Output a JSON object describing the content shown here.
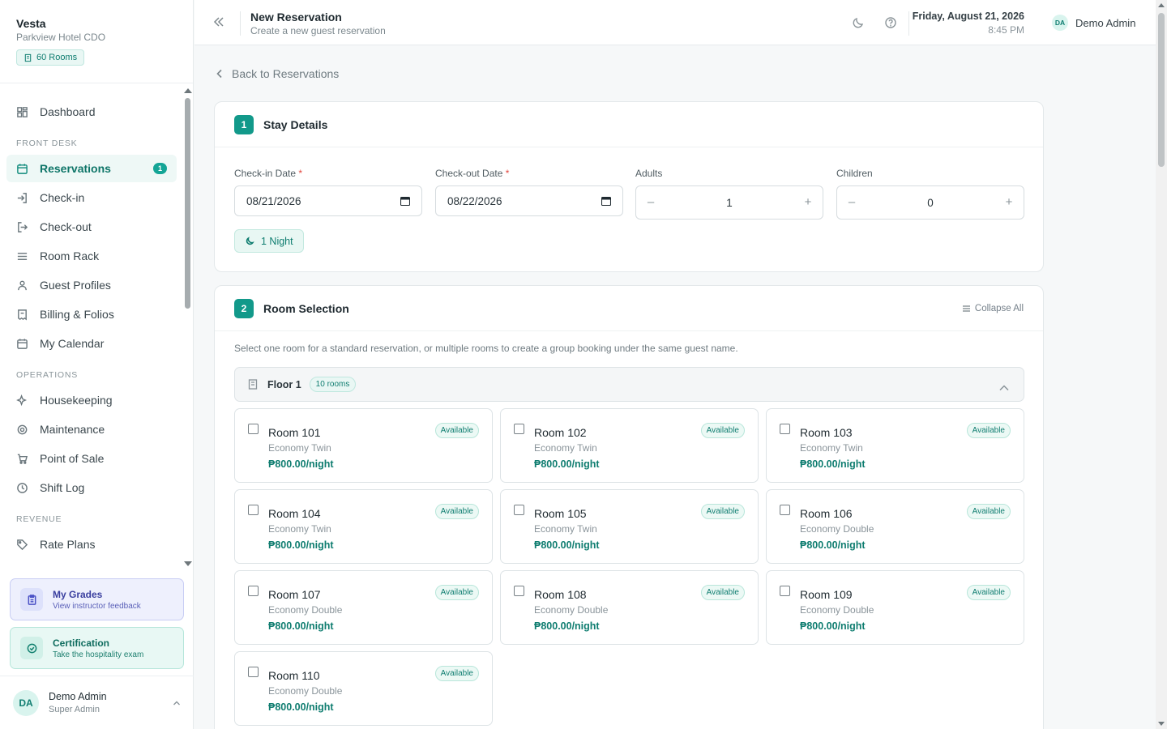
{
  "brand": {
    "name": "Vesta",
    "property": "Parkview Hotel CDO",
    "rooms_pill": "60 Rooms"
  },
  "nav": {
    "dashboard": "Dashboard",
    "section_front_desk": "FRONT DESK",
    "reservations": "Reservations",
    "reservations_badge": "1",
    "check_in": "Check-in",
    "check_out": "Check-out",
    "room_rack": "Room Rack",
    "guest_profiles": "Guest Profiles",
    "billing": "Billing & Folios",
    "my_calendar": "My Calendar",
    "section_operations": "OPERATIONS",
    "housekeeping": "Housekeeping",
    "maintenance": "Maintenance",
    "point_of_sale": "Point of Sale",
    "shift_log": "Shift Log",
    "section_revenue": "REVENUE",
    "rate_plans": "Rate Plans"
  },
  "promos": {
    "grades_title": "My Grades",
    "grades_sub": "View instructor feedback",
    "cert_title": "Certification",
    "cert_sub": "Take the hospitality exam"
  },
  "sidebar_user": {
    "initials": "DA",
    "name": "Demo Admin",
    "role": "Super Admin"
  },
  "header": {
    "title": "New Reservation",
    "subtitle": "Create a new guest reservation",
    "date": "Friday, August 21, 2026",
    "time": "8:45 PM",
    "user_initials": "DA",
    "user_name": "Demo Admin"
  },
  "back_link": "Back to Reservations",
  "stay": {
    "step": "1",
    "title": "Stay Details",
    "checkin_label": "Check-in Date",
    "checkin_value": "08/21/2026",
    "checkout_label": "Check-out Date",
    "checkout_value": "08/22/2026",
    "required_mark": "*",
    "adults_label": "Adults",
    "adults_value": "1",
    "children_label": "Children",
    "children_value": "0",
    "minus": "–",
    "plus": "+",
    "nights": "1 Night"
  },
  "selection": {
    "step": "2",
    "title": "Room Selection",
    "collapse_all": "Collapse All",
    "helper": "Select one room for a standard reservation, or multiple rooms to create a group booking under the same guest name.",
    "floor_name": "Floor 1",
    "floor_count": "10 rooms",
    "rooms": [
      {
        "name": "Room 101",
        "type": "Economy Twin",
        "price": "₱800.00/night",
        "status": "Available"
      },
      {
        "name": "Room 102",
        "type": "Economy Twin",
        "price": "₱800.00/night",
        "status": "Available"
      },
      {
        "name": "Room 103",
        "type": "Economy Twin",
        "price": "₱800.00/night",
        "status": "Available"
      },
      {
        "name": "Room 104",
        "type": "Economy Twin",
        "price": "₱800.00/night",
        "status": "Available"
      },
      {
        "name": "Room 105",
        "type": "Economy Twin",
        "price": "₱800.00/night",
        "status": "Available"
      },
      {
        "name": "Room 106",
        "type": "Economy Double",
        "price": "₱800.00/night",
        "status": "Available"
      },
      {
        "name": "Room 107",
        "type": "Economy Double",
        "price": "₱800.00/night",
        "status": "Available"
      },
      {
        "name": "Room 108",
        "type": "Economy Double",
        "price": "₱800.00/night",
        "status": "Available"
      },
      {
        "name": "Room 109",
        "type": "Economy Double",
        "price": "₱800.00/night",
        "status": "Available"
      },
      {
        "name": "Room 110",
        "type": "Economy Double",
        "price": "₱800.00/night",
        "status": "Available"
      }
    ]
  },
  "colors": {
    "accent": "#12998a",
    "accent_dark": "#0f7d70",
    "required": "#e2453c"
  }
}
